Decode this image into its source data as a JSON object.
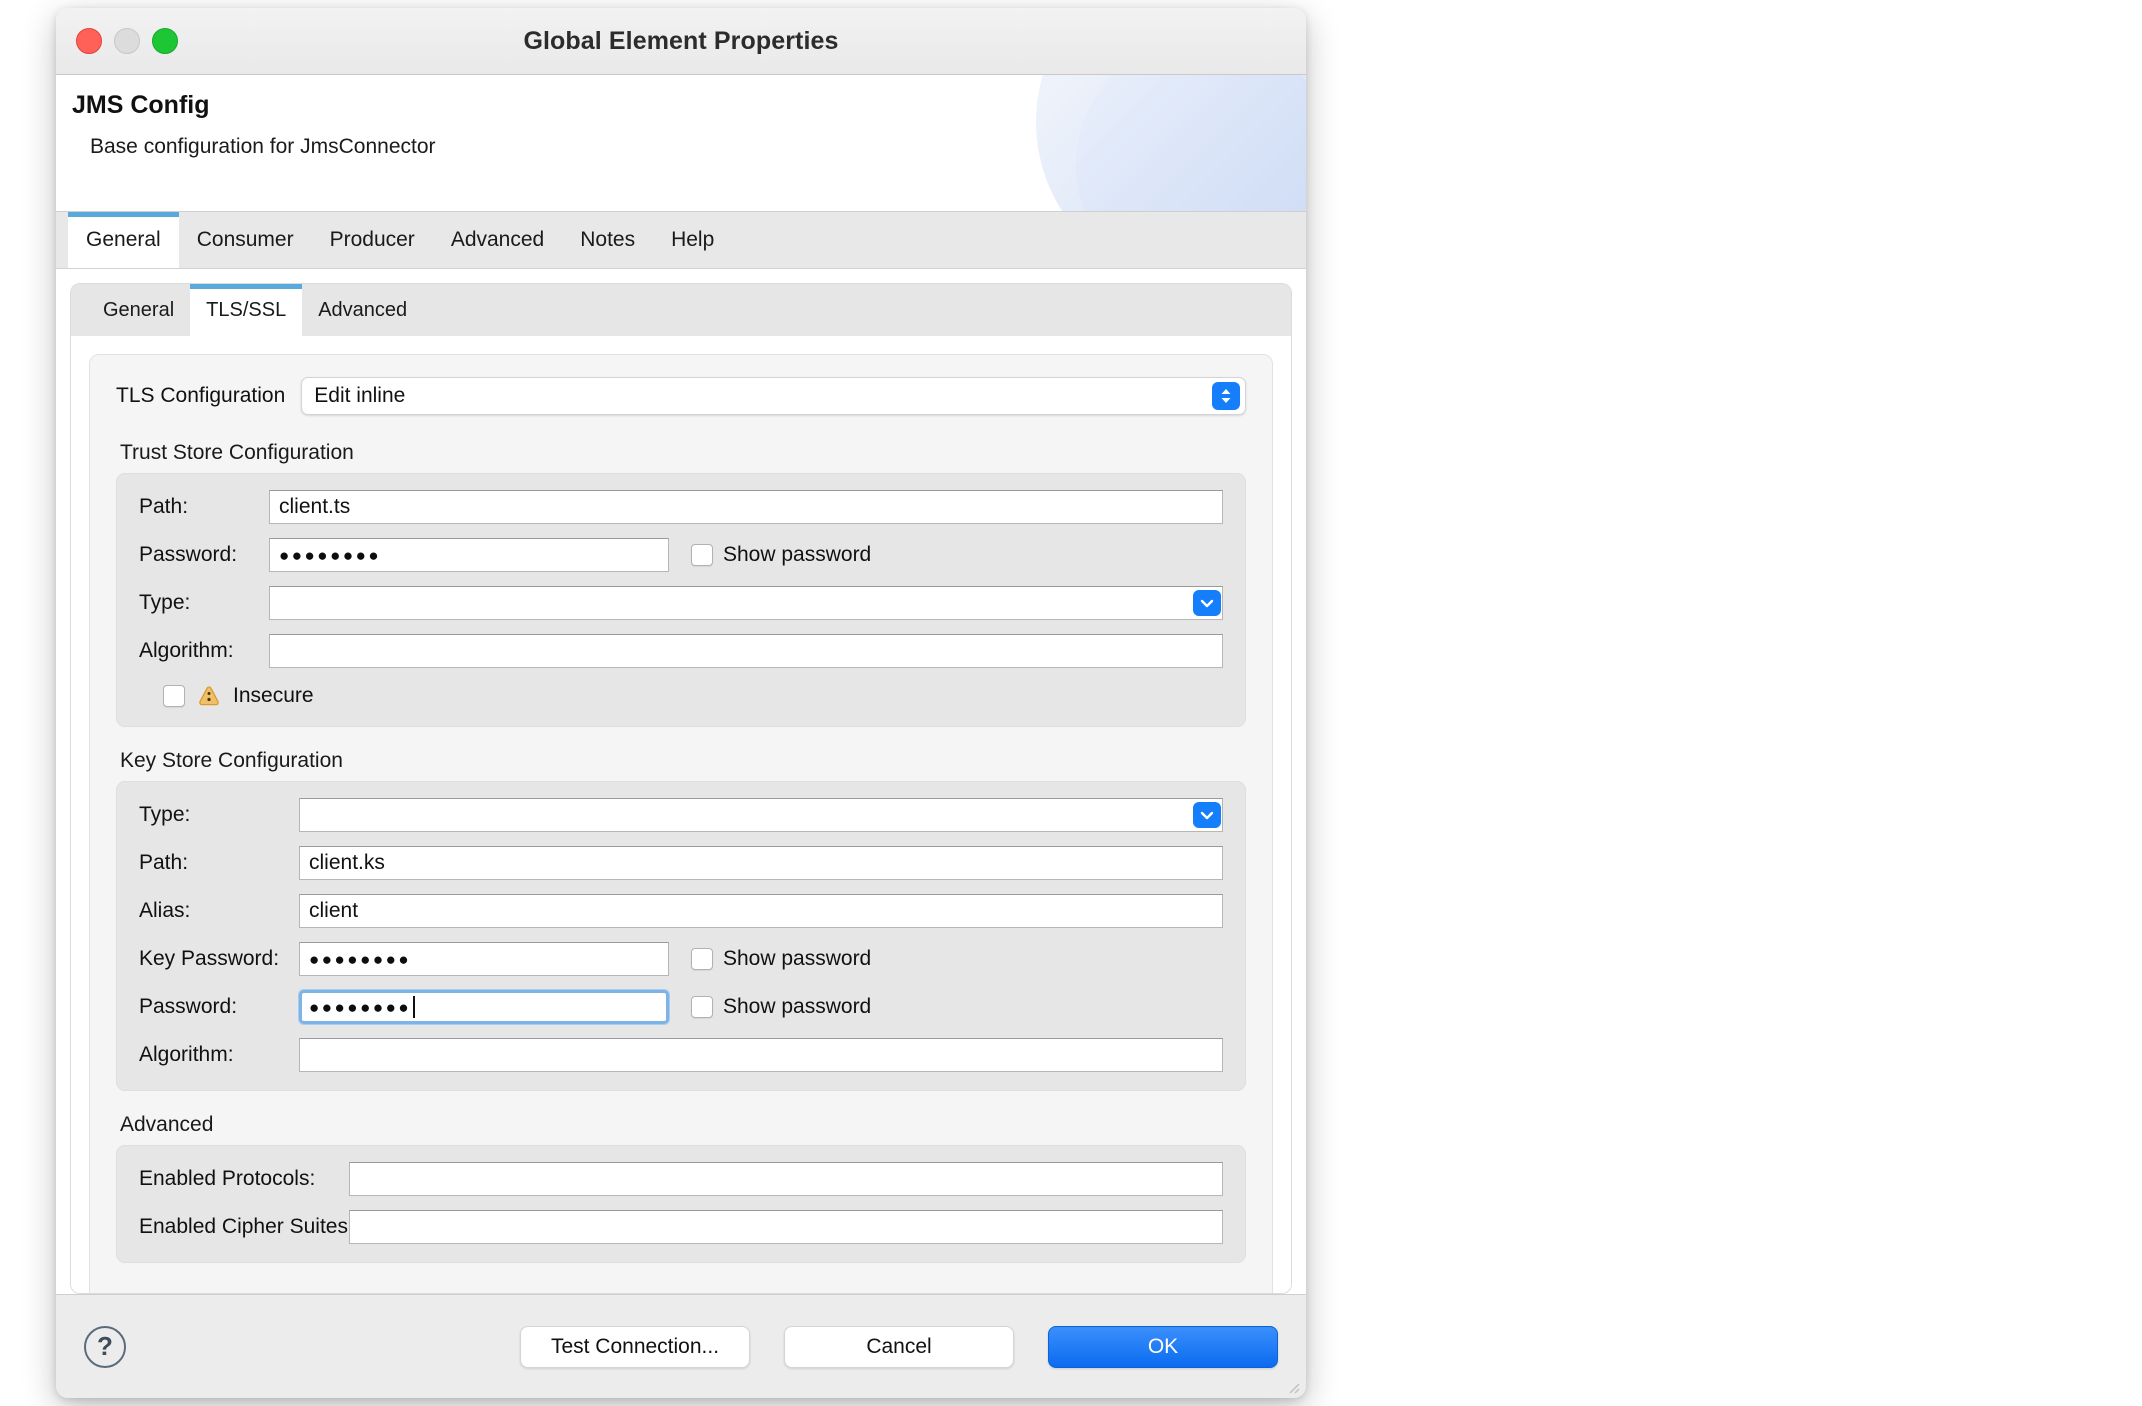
{
  "window": {
    "title": "Global Element Properties",
    "traffic_lights": [
      "close-button",
      "minimize-button",
      "zoom-button"
    ]
  },
  "header": {
    "title": "JMS Config",
    "subtitle": "Base configuration for JmsConnector"
  },
  "outer_tabs": [
    {
      "label": "General",
      "active": true
    },
    {
      "label": "Consumer",
      "active": false
    },
    {
      "label": "Producer",
      "active": false
    },
    {
      "label": "Advanced",
      "active": false
    },
    {
      "label": "Notes",
      "active": false
    },
    {
      "label": "Help",
      "active": false
    }
  ],
  "inner_tabs": [
    {
      "label": "General",
      "active": false
    },
    {
      "label": "TLS/SSL",
      "active": true
    },
    {
      "label": "Advanced",
      "active": false
    }
  ],
  "tls_configuration": {
    "label": "TLS Configuration",
    "value": "Edit inline",
    "options": [
      "Edit inline"
    ]
  },
  "trust_store": {
    "title": "Trust Store Configuration",
    "fields": {
      "path_label": "Path:",
      "path_value": "client.ts",
      "password_label": "Password:",
      "password_value": "●●●●●●●●",
      "password_show_label": "Show password",
      "type_label": "Type:",
      "type_value": "",
      "algorithm_label": "Algorithm:",
      "algorithm_value": "",
      "insecure_label": "Insecure"
    }
  },
  "key_store": {
    "title": "Key Store Configuration",
    "fields": {
      "type_label": "Type:",
      "type_value": "",
      "path_label": "Path:",
      "path_value": "client.ks",
      "alias_label": "Alias:",
      "alias_value": "client",
      "key_password_label": "Key Password:",
      "key_password_value": "●●●●●●●●",
      "key_password_show_label": "Show password",
      "password_label": "Password:",
      "password_value": "●●●●●●●●",
      "password_show_label": "Show password",
      "algorithm_label": "Algorithm:",
      "algorithm_value": ""
    }
  },
  "advanced": {
    "title": "Advanced",
    "fields": {
      "enabled_protocols_label": "Enabled Protocols:",
      "enabled_protocols_value": "",
      "enabled_cipher_suites_label": "Enabled Cipher Suites:",
      "enabled_cipher_suites_value": ""
    }
  },
  "footer": {
    "help_glyph": "?",
    "test_connection_label": "Test Connection...",
    "cancel_label": "Cancel",
    "ok_label": "OK"
  },
  "colors": {
    "accent_blue": "#147efb",
    "tab_indicator": "#5aa9dd",
    "primary_button": "#0a6cf0",
    "warning": "#e9a83b",
    "focus_ring": "#7eb3e8"
  }
}
